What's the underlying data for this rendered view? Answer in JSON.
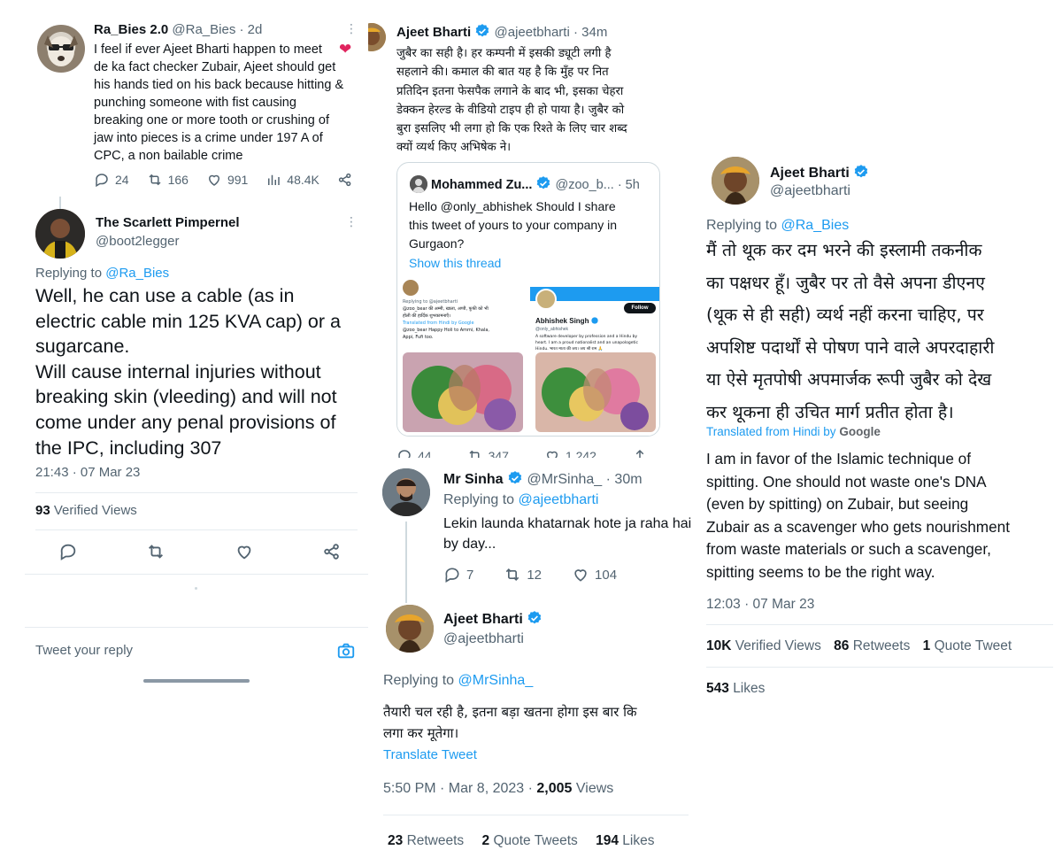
{
  "tweet1": {
    "display_name": "Ra_Bies 2.0",
    "handle": "@Ra_Bies",
    "time": "· 2d",
    "text_lines": [
      "I feel if ever Ajeet Bharti happen to meet",
      "de ka fact checker Zubair, Ajeet should get",
      "his hands tied on his back because hitting &",
      "punching someone with fist causing",
      "breaking one or more tooth or crushing of",
      "jaw into pieces is a crime under 197 A of",
      "CPC, a non bailable crime"
    ],
    "replies": "24",
    "retweets": "166",
    "likes": "991",
    "views": "48.4K"
  },
  "tweet2": {
    "display_name": "The Scarlett Pimpernel",
    "handle": "@boot2legger",
    "replying_to_label": "Replying to",
    "replying_to_handle": "@Ra_Bies",
    "text_lines": [
      "Well, he can use a cable (as in",
      "electric cable min 125 KVA cap) or a",
      "sugarcane.",
      "Will cause internal injuries without",
      "breaking skin (vleeding) and will not",
      "come under any penal provisions of",
      "the IPC, including 307"
    ],
    "timestamp": "21:43 · 07 Mar 23",
    "views_count": "93",
    "views_label": "Verified Views",
    "reply_placeholder": "Tweet your reply"
  },
  "tweet3": {
    "display_name": "Ajeet Bharti",
    "handle": "@ajeetbharti",
    "time": "· 34m",
    "text_lines": [
      "जुबैर का सही है। हर कम्पनी में इसकी ड्यूटी लगी है",
      "सहलाने की। कमाल की बात यह है कि मुँह पर नित",
      "प्रतिदिन इतना फेसपैक लगाने के बाद भी, इसका चेहरा",
      "डेक्कन हेरल्ड के वीडियो टाइप ही हो पाया है। जुबैर को",
      "बुरा इसलिए भी लगा हो कि एक रिश्ते के लिए चार शब्द",
      "क्यों व्यर्थ किए अभिषेक ने।"
    ],
    "quote": {
      "display_name": "Mohammed Zu...",
      "handle": "@zoo_b...",
      "time": "· 5h",
      "text_lines": [
        "Hello @only_abhishek Should I share",
        "this tweet of yours to your company in",
        "Gurgaon?"
      ],
      "show_thread": "Show this thread",
      "left_image": {
        "lines": [
          "Replying to @ajeetbharti",
          "@zoo_bear की अम्मी, खाला, अप्पी, फूफी को भी",
          "होली की हार्दिक शुभकामनाएँ।",
          "Translated from Hindi by Google",
          "@zoo_bear Happy Holi to Ammi, Khala,",
          "Appi, Fufi too."
        ]
      },
      "right_image": {
        "follow_label": "Follow",
        "name": "Abhishek Singh",
        "handle": "@only_abhishek",
        "bio": [
          "A software developer by profession and a Hindu by",
          "heart. I am a proud nationalist and an unapologetic",
          "Hindu. भारत माता की जय। जय श्री राम 🙏"
        ]
      }
    },
    "replies": "44",
    "retweets": "347",
    "likes": "1,242"
  },
  "tweet4": {
    "display_name": "Mr Sinha",
    "handle": "@MrSinha_",
    "time": "· 30m",
    "replying_to_label": "Replying to",
    "replying_to_handle": "@ajeetbharti",
    "text_lines": [
      "Lekin launda khatarnak hote ja raha hai",
      "by day..."
    ],
    "replies": "7",
    "retweets": "12",
    "likes": "104"
  },
  "tweet5": {
    "display_name": "Ajeet Bharti",
    "handle": "@ajeetbharti",
    "replying_to_label": "Replying to",
    "replying_to_handle": "@MrSinha_",
    "text_lines": [
      "तैयारी चल रही है, इतना बड़ा खतना होगा इस बार कि",
      "लगा कर मूतेगा।"
    ],
    "translate": "Translate Tweet",
    "timestamp": "5:50 PM · Mar 8, 2023 · ",
    "views_count": "2,005",
    "views_label": "Views",
    "retweets_count": "23",
    "retweets_label": "Retweets",
    "quotes_count": "2",
    "quotes_label": "Quote Tweets",
    "likes_count": "194",
    "likes_label": "Likes"
  },
  "tweet6": {
    "display_name": "Ajeet Bharti",
    "handle": "@ajeetbharti",
    "replying_to_label": "Replying to",
    "replying_to_handle": "@Ra_Bies",
    "text_lines": [
      "मैं तो थूक कर दम भरने की इस्लामी तकनीक",
      "का पक्षधर हूँ। जुबैर पर तो वैसे अपना डीएनए",
      "(थूक से ही सही) व्यर्थ नहीं करना चाहिए, पर",
      "अपशिष्ट पदार्थों से पोषण पाने वाले अपरदाहारी",
      "या ऐसे मृतपोषी अपमार्जक रूपी जुबैर को देख",
      "कर थूकना ही उचित मार्ग प्रतीत होता है।"
    ],
    "translated_label": "Translated from Hindi by",
    "translated_brand": "Google",
    "translation_lines": [
      "I am in favor of the Islamic technique of",
      "spitting. One should not waste one's DNA",
      "(even by spitting) on Zubair, but seeing",
      "Zubair as a scavenger who gets nourishment",
      "from waste materials or such a scavenger,",
      "spitting seems to be the right way."
    ],
    "timestamp": "12:03 · 07 Mar 23",
    "views_count": "10K",
    "views_label": "Verified Views",
    "retweets_count": "86",
    "retweets_label": "Retweets",
    "quotes_count": "1",
    "quotes_label": "Quote Tweet",
    "likes_count": "543",
    "likes_label": "Likes"
  }
}
